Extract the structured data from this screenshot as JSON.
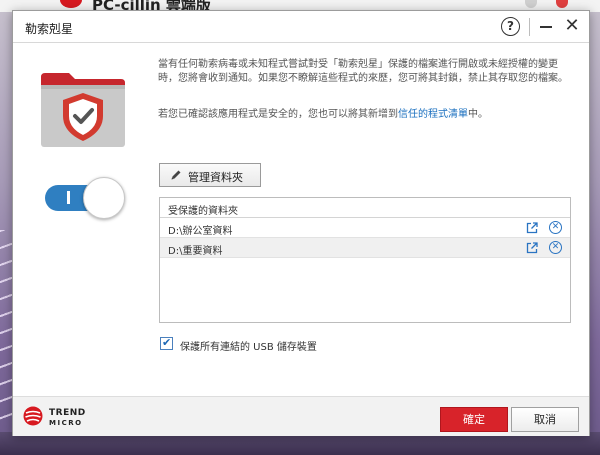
{
  "background_window": {
    "title": "PC-cillin 雲端版"
  },
  "dialog": {
    "title": "勒索剋星",
    "help_label": "?",
    "close_label": "✕"
  },
  "feature": {
    "enabled": true
  },
  "description": {
    "line1": "當有任何勒索病毒或未知程式嘗試對受「勒索剋星」保護的檔案進行開啟或未經授權的變更時，您將會收到通知。如果您不瞭解這些程式的來歷，您可將其封鎖，禁止其存取您的檔案。",
    "line2_prefix": "若您已確認該應用程式是安全的，您也可以將其新增到",
    "line2_link": "信任的程式清單",
    "line2_suffix": "中。"
  },
  "manage_button": {
    "label": "管理資料夾"
  },
  "folder_list": {
    "header": "受保護的資料夾",
    "rows": [
      {
        "path": "D:\\辦公室資料"
      },
      {
        "path": "D:\\重要資料"
      }
    ]
  },
  "usb_option": {
    "checked": true,
    "label": "保護所有連結的 USB 儲存裝置"
  },
  "footer": {
    "brand_line1": "TREND",
    "brand_line2": "MICRO",
    "ok_label": "確定",
    "cancel_label": "取消"
  },
  "colors": {
    "accent": "#2f7fc1",
    "brand_red": "#d8232a",
    "link": "#1a6fbf"
  }
}
